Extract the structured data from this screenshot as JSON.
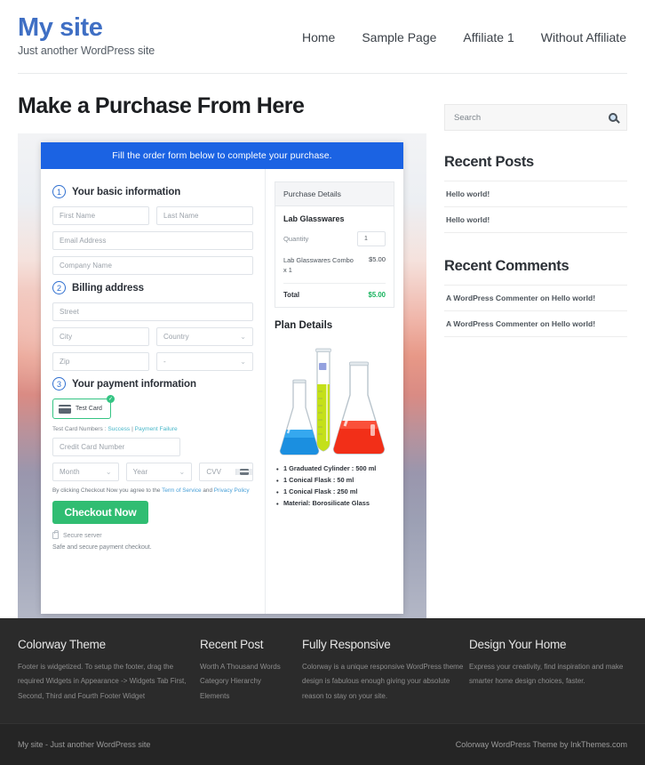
{
  "header": {
    "site_title": "My site",
    "tagline": "Just another WordPress site",
    "nav": [
      {
        "label": "Home"
      },
      {
        "label": "Sample Page"
      },
      {
        "label": "Affiliate 1"
      },
      {
        "label": "Without Affiliate"
      }
    ]
  },
  "main": {
    "page_title": "Make a Purchase From Here",
    "order_banner": "Fill the order form below to complete your purchase.",
    "steps": [
      {
        "num": "1",
        "title": "Your basic information"
      },
      {
        "num": "2",
        "title": "Billing address"
      },
      {
        "num": "3",
        "title": "Your payment information"
      }
    ],
    "fields": {
      "first_name": "First Name",
      "last_name": "Last Name",
      "email": "Email Address",
      "company": "Company Name",
      "street": "Street",
      "city": "City",
      "country": "Country",
      "zip": "Zip",
      "state": "-",
      "credit_card": "Credit Card Number",
      "month": "Month",
      "year": "Year",
      "cvv": "CVV"
    },
    "payment": {
      "card_option": "Test Card",
      "test_prefix": "Test Card Numbers :",
      "test_success": "Success",
      "test_divider": "|",
      "test_failure": "Payment Failure",
      "terms_prefix": "By clicking Checkout Now you agree to the",
      "terms_link1": "Term of Service",
      "terms_and": "and",
      "terms_link2": "Privacy Policy",
      "checkout_label": "Checkout Now",
      "secure_server": "Secure server",
      "safe_note": "Safe and secure payment checkout."
    },
    "summary": {
      "panel_title": "Purchase Details",
      "product": "Lab Glasswares",
      "quantity_label": "Quantity",
      "quantity_value": "1",
      "line_desc": "Lab Glasswares Combo x 1",
      "line_amount": "$5.00",
      "total_label": "Total",
      "total_amount": "$5.00",
      "plan_title": "Plan Details",
      "specs": [
        "1 Graduated Cylinder : 500 ml",
        "1 Conical Flask : 50 ml",
        "1 Conical Flask : 250 ml",
        "Material: Borosilicate Glass"
      ]
    }
  },
  "sidebar": {
    "search_placeholder": "Search",
    "recent_posts_title": "Recent Posts",
    "recent_posts": [
      "Hello world!",
      "Hello world!"
    ],
    "recent_comments_title": "Recent Comments",
    "recent_comments": [
      "A WordPress Commenter on Hello world!",
      "A WordPress Commenter on Hello world!"
    ]
  },
  "footer": {
    "columns": [
      {
        "title": "Colorway Theme",
        "text": "Footer is widgetized. To setup the footer, drag the required Widgets in Appearance -> Widgets Tab First, Second, Third and Fourth Footer Widget"
      },
      {
        "title": "Recent Post",
        "items": [
          "Worth A Thousand Words",
          "Category Hierarchy",
          "Elements"
        ]
      },
      {
        "title": "Fully Responsive",
        "text": "Colorway is a unique responsive WordPress theme design is fabulous enough giving your absolute reason to stay on your site."
      },
      {
        "title": "Design Your Home",
        "text": "Express your creativity, find inspiration and make smarter home design choices, faster."
      }
    ],
    "bar_left": "My site - Just another WordPress site",
    "bar_right": "Colorway WordPress Theme by InkThemes.com"
  },
  "colors": {
    "brand": "#3f6fc4",
    "banner": "#1b63e3",
    "checkout": "#30bd72",
    "total": "#18b35e",
    "step": "#2f6fd0"
  }
}
